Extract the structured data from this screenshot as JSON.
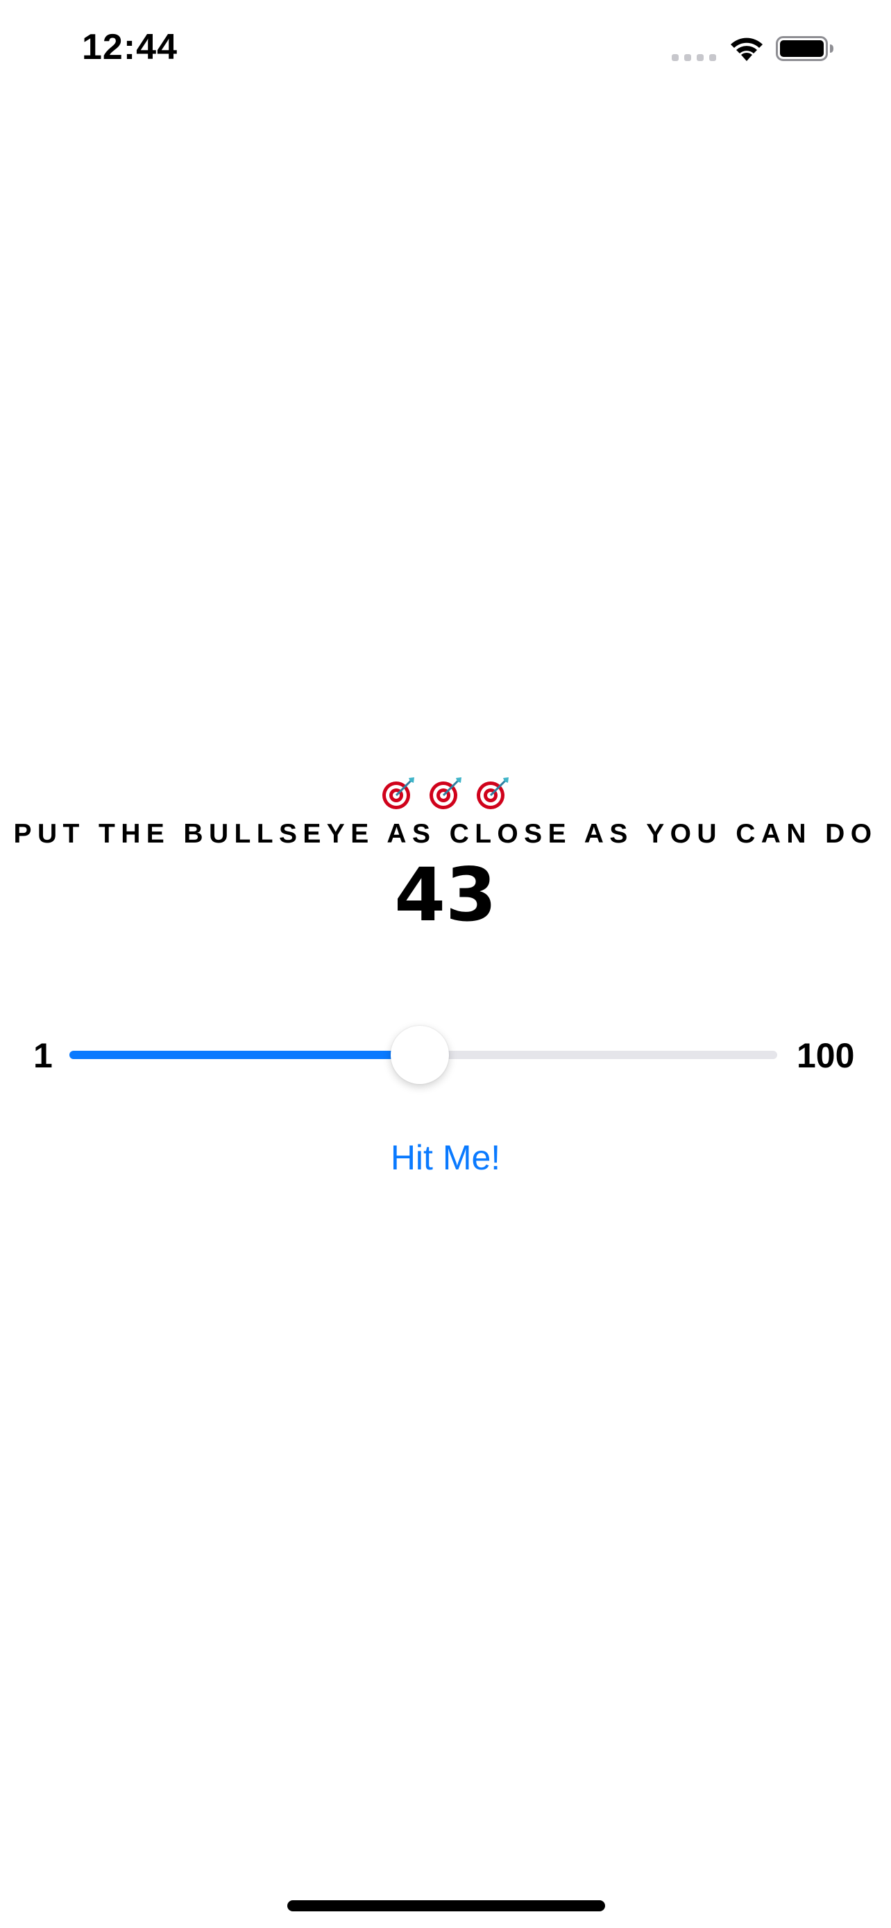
{
  "status_bar": {
    "time": "12:44",
    "icons": [
      "signal-icon",
      "wifi-icon",
      "battery-icon"
    ]
  },
  "game": {
    "decoration_icons": [
      "target-icon",
      "target-icon",
      "target-icon"
    ],
    "instruction": "PUT THE BULLSEYE AS CLOSE AS YOU CAN DO",
    "target_value": "43"
  },
  "slider": {
    "min_label": "1",
    "max_label": "100",
    "min": 1,
    "max": 100,
    "value": 50
  },
  "hit_button": {
    "label": "Hit Me!"
  },
  "colors": {
    "accent": "#0a7aff",
    "track": "#e5e5ea",
    "text": "#000000",
    "background": "#ffffff"
  }
}
